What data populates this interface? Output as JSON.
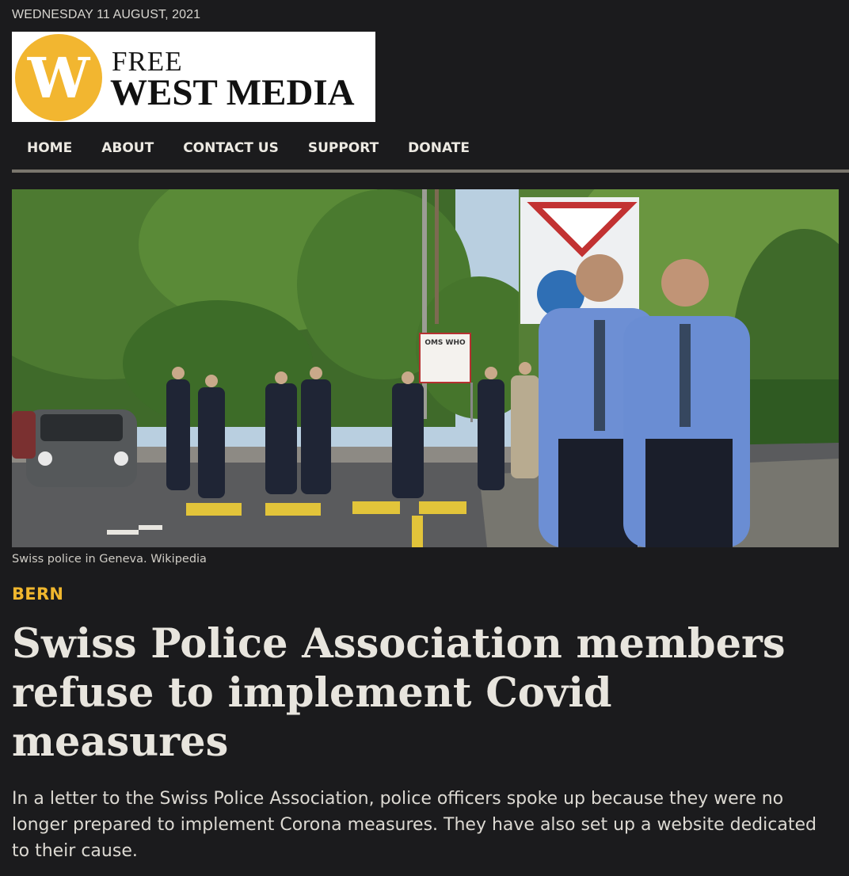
{
  "header": {
    "date": "WEDNESDAY 11 AUGUST, 2021",
    "logo": {
      "monogram": "W",
      "line1": "FREE",
      "line2": "WEST MEDIA",
      "circle_color": "#f2b630"
    }
  },
  "nav": {
    "items": [
      {
        "label": "HOME"
      },
      {
        "label": "ABOUT"
      },
      {
        "label": "CONTACT US"
      },
      {
        "label": "SUPPORT"
      },
      {
        "label": "DONATE"
      }
    ]
  },
  "article": {
    "image_caption": "Swiss police in Geneva. Wikipedia",
    "sign_text": "OMS WHO",
    "category": "BERN",
    "title": "Swiss Police Association members refuse to implement Covid measures",
    "lede": "In a letter to the Swiss Police Association, police officers spoke up because they were no longer prepared to implement Corona measures. They have also set up a website dedicated to their cause."
  },
  "colors": {
    "background": "#1b1b1d",
    "accent": "#f0b72e",
    "nav_rule": "#7a766d",
    "text": "#e8e5de"
  }
}
